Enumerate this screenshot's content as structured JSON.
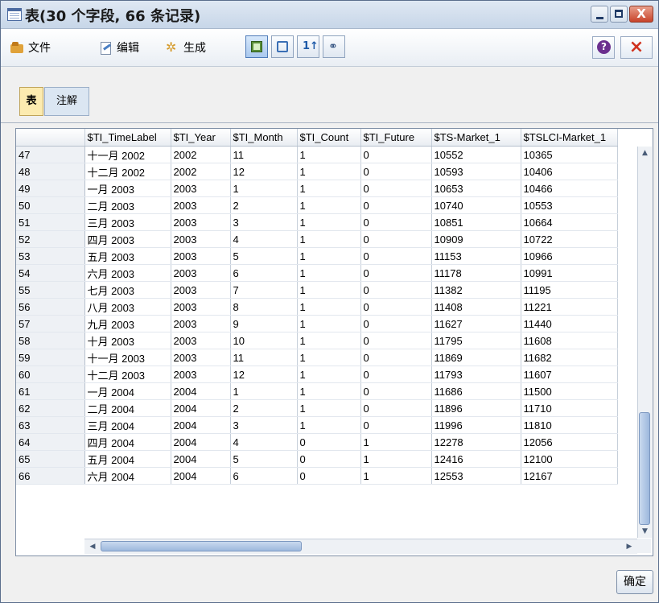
{
  "window": {
    "title": "表(30 个字段, 66 条记录)",
    "controls": {
      "minimize": "_",
      "maximize": "□",
      "close": "X"
    }
  },
  "toolbar": {
    "menus": [
      "文件",
      "编辑",
      "生成"
    ],
    "icons": [
      "table-icon",
      "print-icon",
      "sort-icon",
      "find-icon"
    ],
    "help": "?",
    "close": "×"
  },
  "tabs": [
    "表",
    "注解"
  ],
  "table": {
    "columns": [
      "",
      "$TI_TimeLabel",
      "$TI_Year",
      "$TI_Month",
      "$TI_Count",
      "$TI_Future",
      "$TS-Market_1",
      "$TSLCI-Market_1"
    ],
    "rows": [
      [
        "47",
        "十一月 2002",
        "2002",
        "11",
        "1",
        "0",
        "10552",
        "10365"
      ],
      [
        "48",
        "十二月 2002",
        "2002",
        "12",
        "1",
        "0",
        "10593",
        "10406"
      ],
      [
        "49",
        "一月 2003",
        "2003",
        "1",
        "1",
        "0",
        "10653",
        "10466"
      ],
      [
        "50",
        "二月 2003",
        "2003",
        "2",
        "1",
        "0",
        "10740",
        "10553"
      ],
      [
        "51",
        "三月 2003",
        "2003",
        "3",
        "1",
        "0",
        "10851",
        "10664"
      ],
      [
        "52",
        "四月 2003",
        "2003",
        "4",
        "1",
        "0",
        "10909",
        "10722"
      ],
      [
        "53",
        "五月 2003",
        "2003",
        "5",
        "1",
        "0",
        "11153",
        "10966"
      ],
      [
        "54",
        "六月 2003",
        "2003",
        "6",
        "1",
        "0",
        "11178",
        "10991"
      ],
      [
        "55",
        "七月 2003",
        "2003",
        "7",
        "1",
        "0",
        "11382",
        "11195"
      ],
      [
        "56",
        "八月 2003",
        "2003",
        "8",
        "1",
        "0",
        "11408",
        "11221"
      ],
      [
        "57",
        "九月 2003",
        "2003",
        "9",
        "1",
        "0",
        "11627",
        "11440"
      ],
      [
        "58",
        "十月 2003",
        "2003",
        "10",
        "1",
        "0",
        "11795",
        "11608"
      ],
      [
        "59",
        "十一月 2003",
        "2003",
        "11",
        "1",
        "0",
        "11869",
        "11682"
      ],
      [
        "60",
        "十二月 2003",
        "2003",
        "12",
        "1",
        "0",
        "11793",
        "11607"
      ],
      [
        "61",
        "一月 2004",
        "2004",
        "1",
        "1",
        "0",
        "11686",
        "11500"
      ],
      [
        "62",
        "二月 2004",
        "2004",
        "2",
        "1",
        "0",
        "11896",
        "11710"
      ],
      [
        "63",
        "三月 2004",
        "2004",
        "3",
        "1",
        "0",
        "11996",
        "11810"
      ],
      [
        "64",
        "四月 2004",
        "2004",
        "4",
        "0",
        "1",
        "12278",
        "12056"
      ],
      [
        "65",
        "五月 2004",
        "2004",
        "5",
        "0",
        "1",
        "12416",
        "12100"
      ],
      [
        "66",
        "六月 2004",
        "2004",
        "6",
        "0",
        "1",
        "12553",
        "12167"
      ]
    ]
  },
  "footer": {
    "ok": "确定"
  }
}
